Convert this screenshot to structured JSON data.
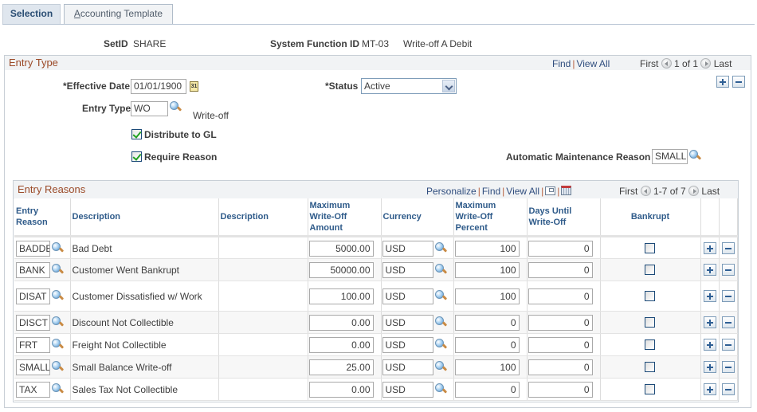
{
  "tabs": [
    {
      "label": "Selection",
      "active": true
    },
    {
      "label": "Accounting Template",
      "active": false,
      "accesskey": "A",
      "rest": "ccounting Template"
    }
  ],
  "header": {
    "setid_label": "SetID",
    "setid_value": "SHARE",
    "sysfunc_label": "System Function ID",
    "sysfunc_value": "MT-03",
    "sysfunc_desc": "Write-off A Debit"
  },
  "entry_type": {
    "title": "Entry Type",
    "nav": {
      "find": "Find",
      "view_all": "View All",
      "first": "First",
      "range": "1 of 1",
      "last": "Last"
    },
    "effective_date_label": "*Effective Date",
    "effective_date": "01/01/1900",
    "calendar_glyph": "31",
    "status_label": "*Status",
    "status_value": "Active",
    "entry_type_label": "Entry Type",
    "entry_type_value": "WO",
    "entry_type_desc": "Write-off",
    "distribute_gl_label": "Distribute to GL",
    "distribute_gl_checked": true,
    "require_reason_label": "Require Reason",
    "require_reason_checked": true,
    "auto_maint_label": "Automatic Maintenance Reason",
    "auto_maint_value": "SMALL"
  },
  "entry_reasons": {
    "title": "Entry Reasons",
    "nav": {
      "personalize": "Personalize",
      "find": "Find",
      "view_all": "View All",
      "first": "First",
      "range": "1-7 of 7",
      "last": "Last"
    },
    "columns": {
      "reason": [
        "Entry",
        "Reason"
      ],
      "description": "Description",
      "description2": "Description",
      "max_amount": [
        "Maximum",
        "Write-Off",
        "Amount"
      ],
      "currency": "Currency",
      "max_percent": [
        "Maximum",
        "Write-Off",
        "Percent"
      ],
      "days": [
        "Days Until",
        "Write-Off"
      ],
      "bankrupt": "Bankrupt"
    },
    "rows": [
      {
        "reason": "BADDB",
        "description": "Bad Debt",
        "description2": "",
        "max_amount": "5000.00",
        "currency": "USD",
        "max_percent": "100",
        "days": "0",
        "bankrupt": false
      },
      {
        "reason": "BANK",
        "description": "Customer Went Bankrupt",
        "description2": "",
        "max_amount": "50000.00",
        "currency": "USD",
        "max_percent": "100",
        "days": "0",
        "bankrupt": false
      },
      {
        "reason": "DISAT",
        "description": "Customer Dissatisfied w/ Work",
        "description2": "",
        "max_amount": "100.00",
        "currency": "USD",
        "max_percent": "100",
        "days": "0",
        "bankrupt": false
      },
      {
        "reason": "DISCT",
        "description": "Discount Not Collectible",
        "description2": "",
        "max_amount": "0.00",
        "currency": "USD",
        "max_percent": "0",
        "days": "0",
        "bankrupt": false
      },
      {
        "reason": "FRT",
        "description": "Freight Not Collectible",
        "description2": "",
        "max_amount": "0.00",
        "currency": "USD",
        "max_percent": "0",
        "days": "0",
        "bankrupt": false
      },
      {
        "reason": "SMALL",
        "description": "Small Balance Write-off",
        "description2": "",
        "max_amount": "25.00",
        "currency": "USD",
        "max_percent": "100",
        "days": "0",
        "bankrupt": false
      },
      {
        "reason": "TAX",
        "description": "Sales Tax Not Collectible",
        "description2": "",
        "max_amount": "0.00",
        "currency": "USD",
        "max_percent": "0",
        "days": "0",
        "bankrupt": false
      }
    ]
  }
}
